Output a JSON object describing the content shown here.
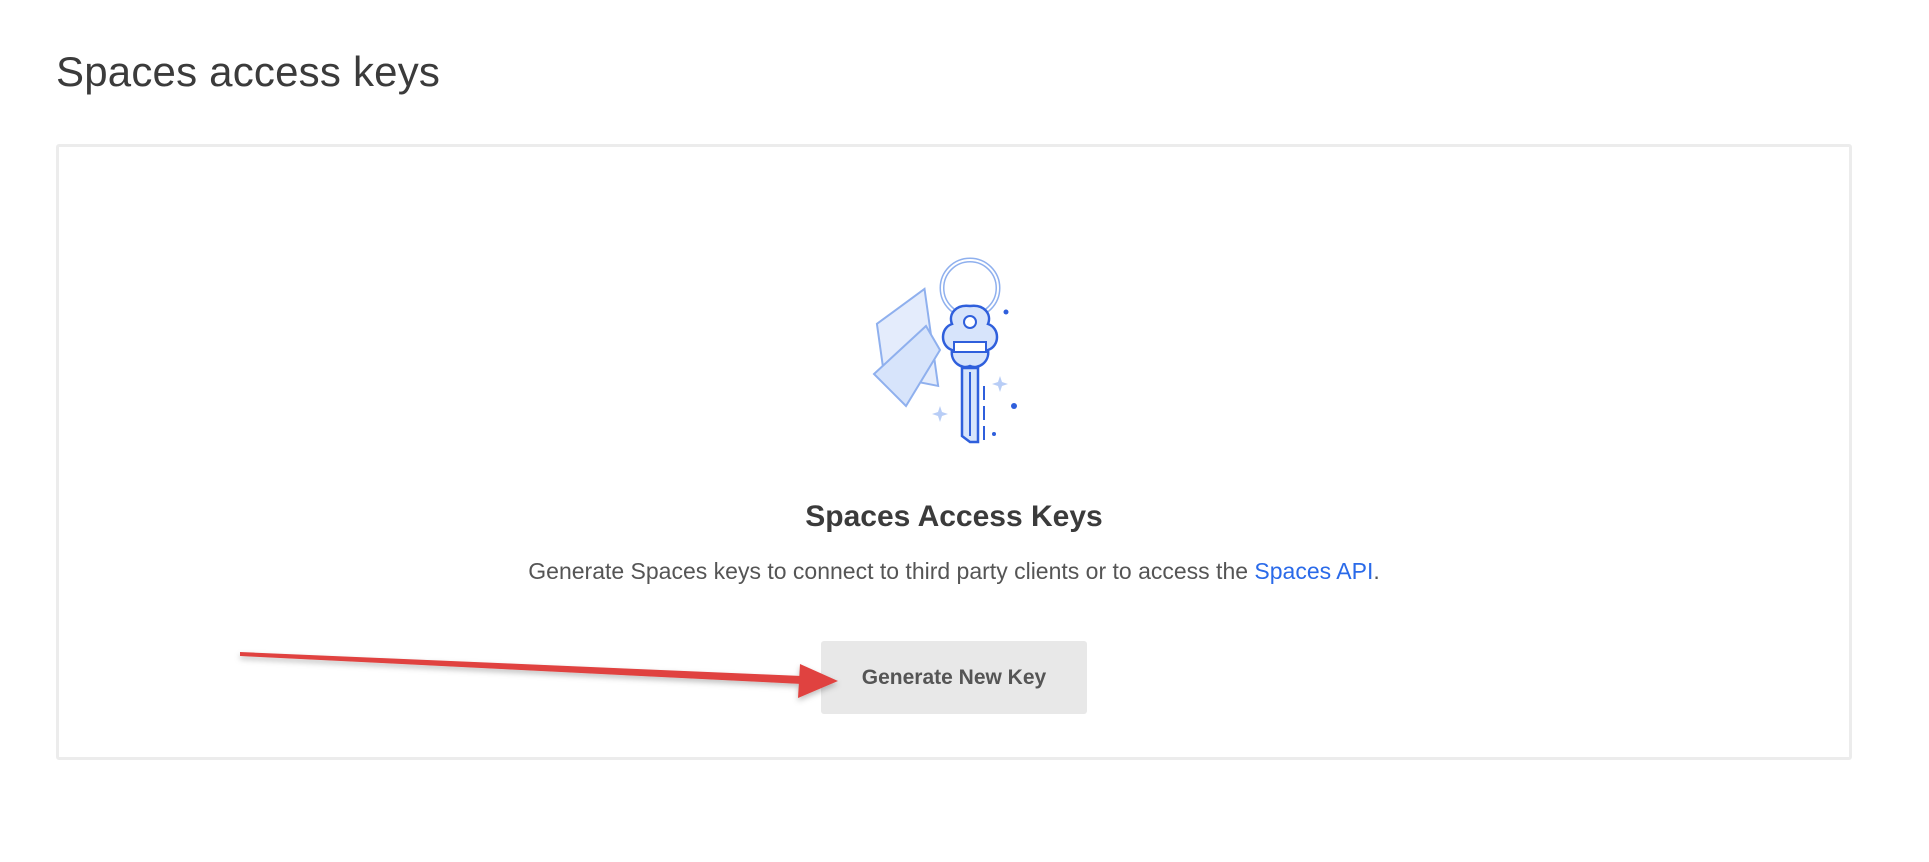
{
  "header": {
    "title": "Spaces access keys"
  },
  "empty_state": {
    "illustration": "keyring-icon",
    "title": "Spaces Access Keys",
    "description_prefix": "Generate Spaces keys to connect to third party clients or to access the ",
    "link_label": "Spaces API",
    "description_suffix": ".",
    "button_label": "Generate New Key"
  },
  "annotation": {
    "arrow_color": "#e0433f"
  },
  "colors": {
    "link": "#2a6ae9",
    "button_bg": "#e8e8e8",
    "illustration_stroke": "#2f5fdc",
    "illustration_fill": "#d7e4fb"
  }
}
